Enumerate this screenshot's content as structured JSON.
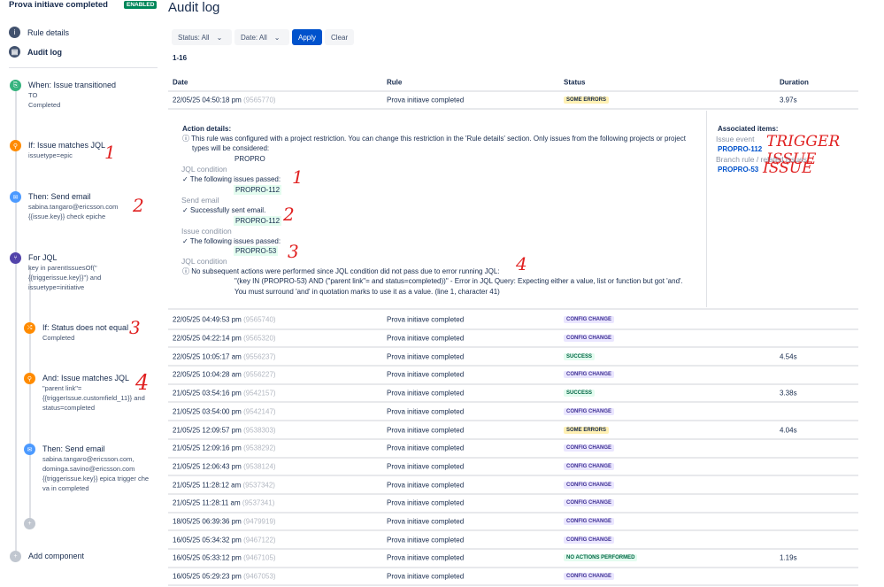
{
  "sidebar": {
    "rule_name": "Prova initiave completed",
    "status_badge": "ENABLED",
    "nav": [
      {
        "label": "Rule details"
      },
      {
        "label": "Audit log"
      }
    ],
    "components": [
      {
        "title": "When: Issue transitioned",
        "lines": [
          "TO",
          "Completed"
        ]
      },
      {
        "title": "If: Issue matches JQL",
        "lines": [
          "issuetype=epic"
        ]
      },
      {
        "title": "Then: Send email",
        "lines": [
          "sabina.tangaro@ericsson.com",
          "{{issue.key}} check epiche"
        ]
      },
      {
        "title": "For JQL",
        "lines": [
          "key in parentIssuesOf(\"",
          "{{triggerissue.key}}\") and",
          "issuetype=initiative"
        ]
      },
      {
        "title": "If: Status does not equal",
        "lines": [
          "Completed"
        ]
      },
      {
        "title": "And: Issue matches JQL",
        "lines": [
          "\"parent link\"=",
          "{{triggerIssue.customfield_11}} and",
          "status=completed"
        ]
      },
      {
        "title": "Then: Send email",
        "lines": [
          "sabina.tangaro@ericsson.com,",
          "dominga.savino@ericsson.com",
          "{{triggerissue.key}} epica trigger che",
          "va in completed"
        ]
      }
    ],
    "add_component": "Add component"
  },
  "annotations": {
    "n1": "1",
    "n2": "2",
    "n3": "3",
    "n4": "4",
    "trigger": "TRIGGER ISSUE",
    "issue": "ISSUE"
  },
  "main": {
    "title": "Audit log",
    "filters": {
      "status": "Status: All",
      "date": "Date: All",
      "apply": "Apply",
      "clear": "Clear"
    },
    "count": "1-16",
    "columns": [
      "Date",
      "Rule",
      "Status",
      "Duration"
    ],
    "expanded_row": {
      "date": "22/05/25 04:50:18 pm",
      "id": "(9565770)",
      "rule": "Prova initiave completed",
      "status": "SOME ERRORS",
      "duration": "3.97s"
    },
    "details": {
      "heading": "Action details:",
      "restriction": "This rule was configured with a project restriction. You can change this restriction in the 'Rule details' section. Only issues from the following projects or project",
      "restriction2": "types will be considered:",
      "project": "PROPRO",
      "s1_title": "JQL condition",
      "s1_msg": "The following issues passed:",
      "s1_key": "PROPRO-112",
      "s2_title": "Send email",
      "s2_msg": "Successfully sent email.",
      "s2_key": "PROPRO-112",
      "s3_title": "Issue condition",
      "s3_msg": "The following issues passed:",
      "s3_key": "PROPRO-53",
      "s4_title": "JQL condition",
      "s4_msg": "No subsequent actions were performed since JQL condition did not pass due to error running JQL:",
      "s4_err1": "\"(key IN (PROPRO-53) AND (\"parent link\"= and status=completed))\" - Error in JQL Query: Expecting either a value, list or function but got 'and'.",
      "s4_err2": "You must surround 'and' in quotation marks to use it as a value. (line 1, character 41)"
    },
    "associated": {
      "heading": "Associated items:",
      "event_label": "Issue event",
      "event_key": "PROPRO-112",
      "branch_label": "Branch rule / related issues",
      "branch_key": "PROPRO-53"
    },
    "rows": [
      {
        "date": "22/05/25 04:49:53 pm",
        "id": "(9565740)",
        "rule": "Prova initiave completed",
        "status": "CONFIG CHANGE",
        "duration": ""
      },
      {
        "date": "22/05/25 04:22:14 pm",
        "id": "(9565320)",
        "rule": "Prova initiave completed",
        "status": "CONFIG CHANGE",
        "duration": ""
      },
      {
        "date": "22/05/25 10:05:17 am",
        "id": "(9556237)",
        "rule": "Prova initiave completed",
        "status": "SUCCESS",
        "duration": "4.54s"
      },
      {
        "date": "22/05/25 10:04:28 am",
        "id": "(9556227)",
        "rule": "Prova initiave completed",
        "status": "CONFIG CHANGE",
        "duration": ""
      },
      {
        "date": "21/05/25 03:54:16 pm",
        "id": "(9542157)",
        "rule": "Prova initiave completed",
        "status": "SUCCESS",
        "duration": "3.38s"
      },
      {
        "date": "21/05/25 03:54:00 pm",
        "id": "(9542147)",
        "rule": "Prova initiave completed",
        "status": "CONFIG CHANGE",
        "duration": ""
      },
      {
        "date": "21/05/25 12:09:57 pm",
        "id": "(9538303)",
        "rule": "Prova initiave completed",
        "status": "SOME ERRORS",
        "duration": "4.04s"
      },
      {
        "date": "21/05/25 12:09:16 pm",
        "id": "(9538292)",
        "rule": "Prova initiave completed",
        "status": "CONFIG CHANGE",
        "duration": ""
      },
      {
        "date": "21/05/25 12:06:43 pm",
        "id": "(9538124)",
        "rule": "Prova initiave completed",
        "status": "CONFIG CHANGE",
        "duration": ""
      },
      {
        "date": "21/05/25 11:28:12 am",
        "id": "(9537342)",
        "rule": "Prova initiave completed",
        "status": "CONFIG CHANGE",
        "duration": ""
      },
      {
        "date": "21/05/25 11:28:11 am",
        "id": "(9537341)",
        "rule": "Prova initiave completed",
        "status": "CONFIG CHANGE",
        "duration": ""
      },
      {
        "date": "18/05/25 06:39:36 pm",
        "id": "(9479919)",
        "rule": "Prova initiave completed",
        "status": "CONFIG CHANGE",
        "duration": ""
      },
      {
        "date": "16/05/25 05:34:32 pm",
        "id": "(9467122)",
        "rule": "Prova initiave completed",
        "status": "CONFIG CHANGE",
        "duration": ""
      },
      {
        "date": "16/05/25 05:33:12 pm",
        "id": "(9467105)",
        "rule": "Prova initiave completed",
        "status": "NO ACTIONS PERFORMED",
        "duration": "1.19s"
      },
      {
        "date": "16/05/25 05:29:23 pm",
        "id": "(9467053)",
        "rule": "Prova initiave completed",
        "status": "CONFIG CHANGE",
        "duration": ""
      }
    ]
  },
  "status_colors": {
    "CONFIG CHANGE": [
      "#eae6ff",
      "#403294"
    ],
    "SUCCESS": [
      "#e3fcef",
      "#006644"
    ],
    "SOME ERRORS": [
      "#fff0b3",
      "#172b4d"
    ],
    "NO ACTIONS PERFORMED": [
      "#e3fcef",
      "#006644"
    ]
  }
}
